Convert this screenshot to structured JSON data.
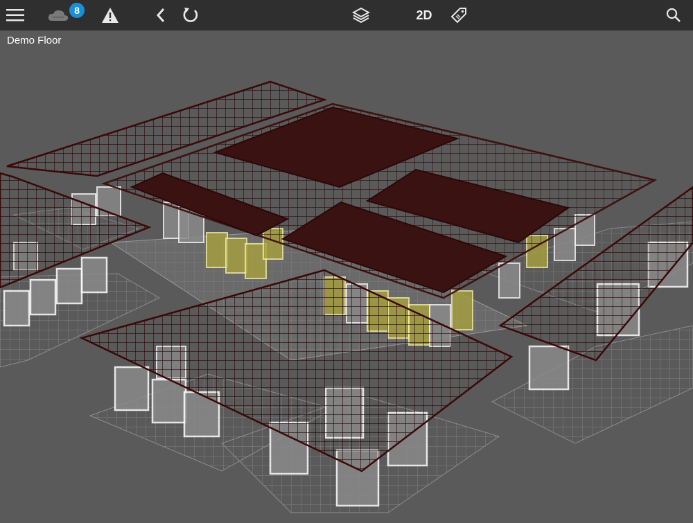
{
  "toolbar": {
    "menu_icon": "hamburger-menu-icon",
    "cloud_icon": "cloud-sync-icon",
    "notification_count": "8",
    "warning_icon": "warning-triangle-icon",
    "back_icon": "chevron-left-icon",
    "refresh_icon": "refresh-icon",
    "layers_icon": "layers-icon",
    "view_mode_label": "2D",
    "tag_icon": "tag-icon",
    "search_icon": "search-icon"
  },
  "floor": {
    "title": "Demo Floor"
  },
  "colors": {
    "toolbar_bg": "#2f2f2f",
    "canvas_bg": "#5a5a5a",
    "badge": "#1a8fd6",
    "roof_fill": "#3a1212",
    "grid_line": "#3c1010",
    "rack_highlight": "#d8d23a"
  }
}
